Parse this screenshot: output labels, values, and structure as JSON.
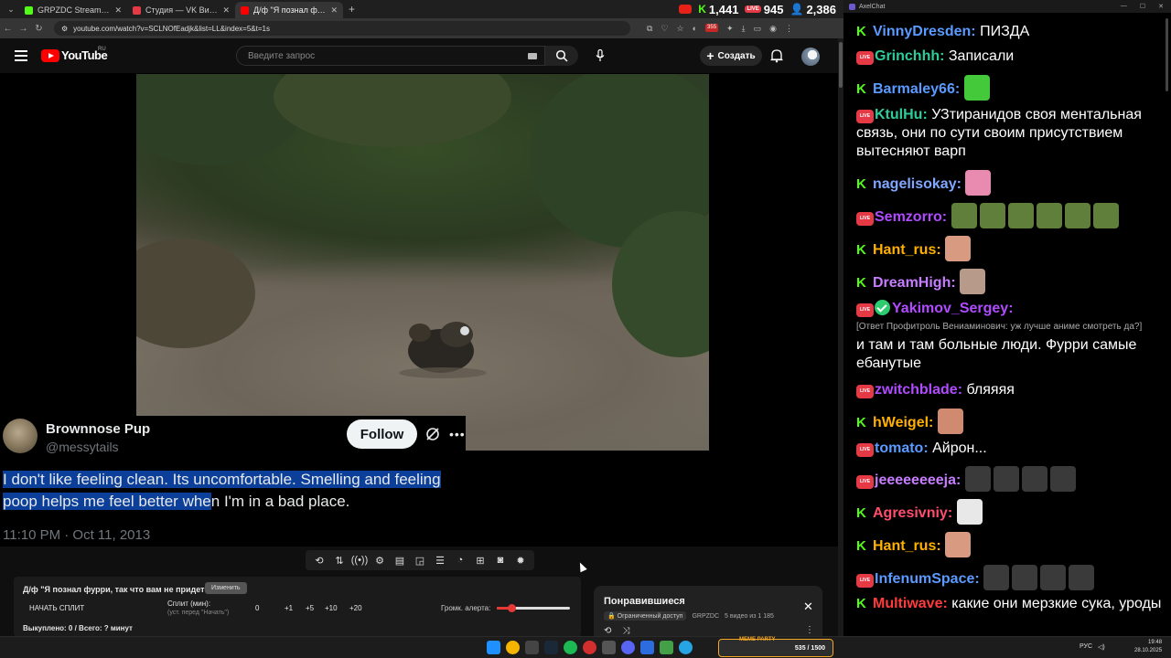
{
  "browser": {
    "tabs": [
      {
        "label": "GRPZDC Stream - Watch Live o",
        "color": "#53fc18"
      },
      {
        "label": "Студия — VK Видео Live",
        "color": "#e63946"
      },
      {
        "label": "Д/ф \"Я познал фурри, так",
        "color": "#ff0000"
      }
    ],
    "url": "youtube.com/watch?v=SCLNOfEadjk&list=LL&index=5&t=1s",
    "stats": {
      "kick": "1,441",
      "vk": "945",
      "viewers": "2,386"
    },
    "ext_badge": "355"
  },
  "youtube": {
    "logo_text": "YouTube",
    "region": "RU",
    "search_placeholder": "Введите запрос",
    "create_label": "Создать"
  },
  "tweet": {
    "name": "Brownnose Pup",
    "handle": "@messytails",
    "follow_label": "Follow",
    "text_highlighted": "I don't like feeling clean. Its uncomfortable. Smelling and feeling poop helps me feel better whe",
    "text_rest": "n I'm in a bad place.",
    "date": "11:10 PM · Oct 11, 2013"
  },
  "split_panel": {
    "title": "Д/ф \"Я познал фурри, так что вам не придется\"",
    "change_label": "Изменить",
    "start_label": "НАЧАТЬ СПЛИТ",
    "split_label": "Сплит (мин):",
    "split_hint": "(уст. перед \"Начать\")",
    "current": "0",
    "steps": [
      "+1",
      "+5",
      "+10",
      "+20"
    ],
    "alert_label": "Громк. алерта:",
    "alert_volume": 0.2,
    "bought": "Выкуплено: 0 / Всего: ? минут"
  },
  "liked": {
    "title": "Понравившиеся",
    "access": "Ограниченный доступ",
    "channel": "GRPZDC",
    "count": "5 видео из 1 185"
  },
  "chat": {
    "window_title": "AxelChat",
    "messages": [
      {
        "platform": "kick",
        "name": "VinnyDresden",
        "color": "#5b9bff",
        "text": "ПИЗДА"
      },
      {
        "platform": "vk",
        "name": "Grinchhh",
        "color": "#2ecc9a",
        "text": "Записали"
      },
      {
        "platform": "kick",
        "name": "Barmaley66",
        "color": "#5b9bff",
        "text": "",
        "emotes": [
          "#43c93a"
        ]
      },
      {
        "platform": "vk",
        "name": "KtulHu",
        "color": "#2ecc9a",
        "text": "УЗтиранидов своя ментальная связь, они по сути своим присутствием вытесняют варп"
      },
      {
        "platform": "kick",
        "name": "nagelisokay",
        "color": "#7fa7ff",
        "text": "",
        "emotes": [
          "#e98bb0"
        ]
      },
      {
        "platform": "vk",
        "name": "Semzorro",
        "color": "#b14bff",
        "text": "",
        "emotes": [
          "#5f7f3a",
          "#5f7f3a",
          "#5f7f3a",
          "#5f7f3a",
          "#5f7f3a",
          "#5f7f3a"
        ]
      },
      {
        "platform": "kick",
        "name": "Hant_rus",
        "color": "#ffb000",
        "text": "",
        "emotes": [
          "#d89a80"
        ]
      },
      {
        "platform": "kick",
        "name": "DreamHigh",
        "color": "#c77dff",
        "text": "",
        "emotes": [
          "#b79a8a"
        ]
      },
      {
        "platform": "vk",
        "name": "Yakimov_Sergey",
        "color": "#b14bff",
        "mod": true,
        "reply": "[Ответ Профитроль Вениаминович: уж лучше аниме смотреть да?]",
        "text": "и там и там больные люди. Фурри самые ебанутые"
      },
      {
        "platform": "vk",
        "name": "zwitchblade",
        "color": "#b14bff",
        "text": "бляяяя"
      },
      {
        "platform": "kick",
        "name": "hWeigel",
        "color": "#ffb000",
        "text": "",
        "emotes": [
          "#d08a70"
        ]
      },
      {
        "platform": "vk",
        "name": "tomato",
        "color": "#5b9bff",
        "text": "Айрон..."
      },
      {
        "platform": "vk",
        "name": "jeeeeeeeeja",
        "color": "#c77dff",
        "text": "",
        "emotes": [
          "#3a3a3a",
          "#3a3a3a",
          "#3a3a3a",
          "#3a3a3a"
        ]
      },
      {
        "platform": "kick",
        "name": "Agresivniy",
        "color": "#ff4d6d",
        "text": "",
        "emotes": [
          "#e8e8e8"
        ]
      },
      {
        "platform": "kick",
        "name": "Hant_rus",
        "color": "#ffb000",
        "text": "",
        "emotes": [
          "#d89a80"
        ]
      },
      {
        "platform": "vk",
        "name": "InfenumSpace",
        "color": "#5b9bff",
        "text": "",
        "emotes": [
          "#3a3a3a",
          "#3a3a3a",
          "#3a3a3a",
          "#3a3a3a"
        ]
      },
      {
        "platform": "kick",
        "name": "Multiwave",
        "color": "#ff3b3b",
        "text": "какие они мерзкие сука, уроды"
      }
    ]
  },
  "taskbar": {
    "meme_label": "MEME PARTY",
    "meme_value": "535 / 1500",
    "lang": "РУС",
    "time": "19:48",
    "date": "28.10.2025"
  }
}
